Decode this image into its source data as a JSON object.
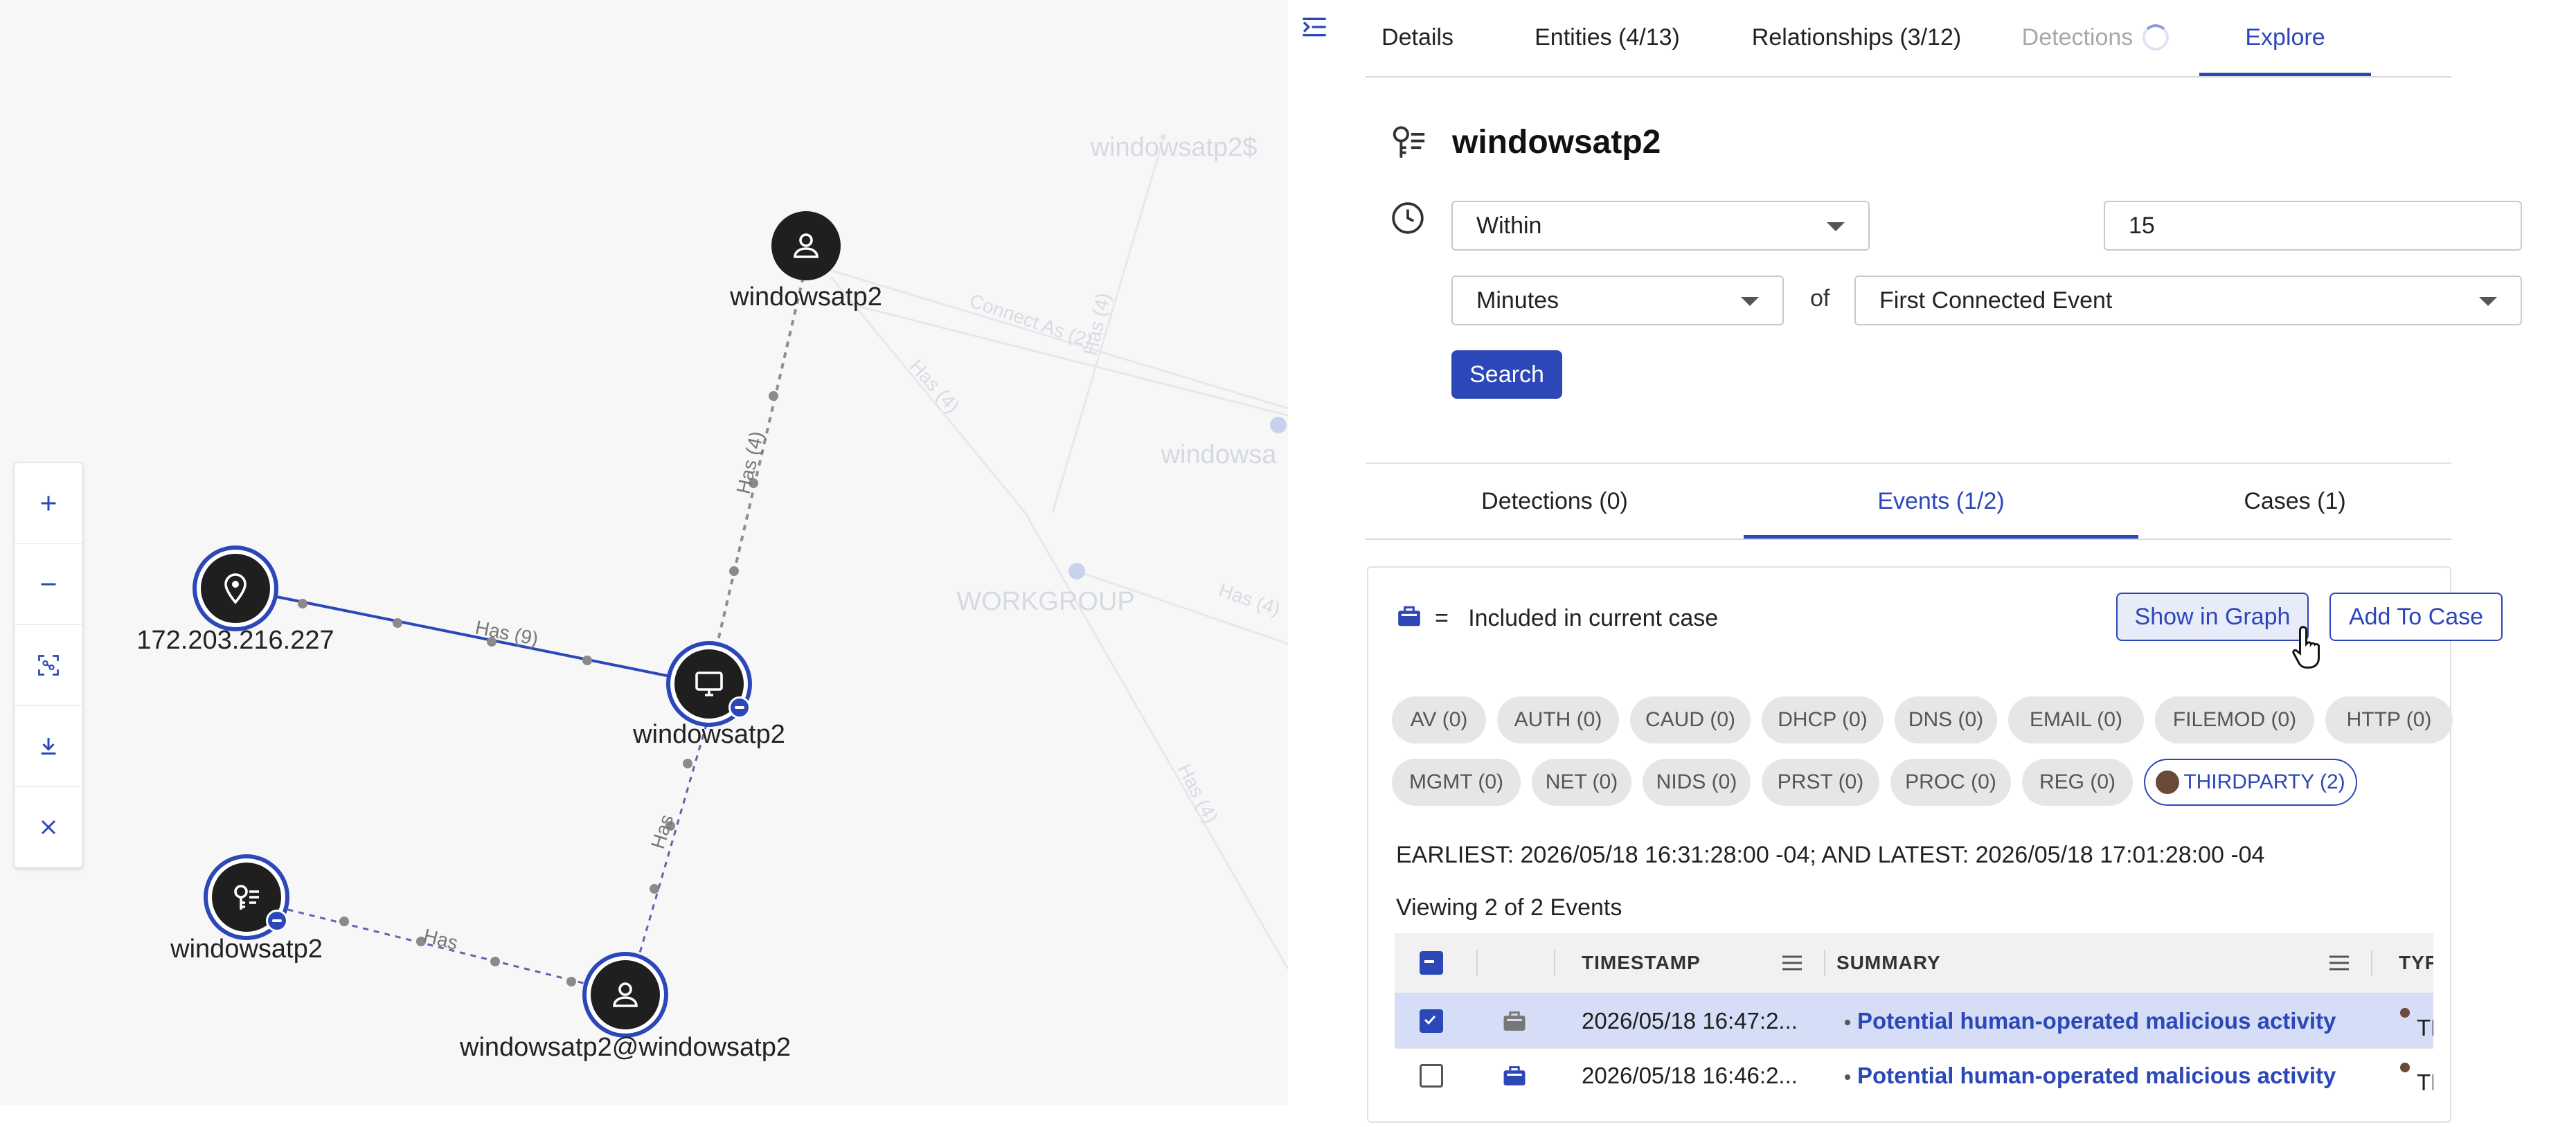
{
  "graph": {
    "nodes": [
      {
        "id": "user-top",
        "label": "windowsatp2",
        "icon": "user-icon"
      },
      {
        "id": "ip",
        "label": "172.203.216.227",
        "icon": "location-pin-icon"
      },
      {
        "id": "host",
        "label": "windowsatp2",
        "icon": "monitor-icon"
      },
      {
        "id": "key",
        "label": "windowsatp2",
        "icon": "key-list-icon"
      },
      {
        "id": "user-bottom",
        "label": "windowsatp2@windowsatp2",
        "icon": "user-icon"
      }
    ],
    "edge_labels": {
      "ip_host": "Has (9)",
      "user_host": "Has (4)",
      "host_userbottom": "Has",
      "key_userbottom": "Has"
    },
    "background_labels": {
      "windowsatp2_dollar": "windowsatp2$",
      "windowsa": "windowsa",
      "workgroup": "WORKGROUP",
      "connect_as": "Connect As (2)",
      "has4_a": "Has (4)",
      "has4_b": "Has (4)",
      "has4_c": "Has (4)",
      "has4_d": "Has (4)"
    },
    "controls": [
      "zoom-in-icon",
      "zoom-out-icon",
      "fit-view-icon",
      "download-icon",
      "close-icon"
    ]
  },
  "panel": {
    "tabs": [
      {
        "label": "Details",
        "state": "normal"
      },
      {
        "label": "Entities  (4/13)",
        "state": "normal"
      },
      {
        "label": "Relationships  (3/12)",
        "state": "normal"
      },
      {
        "label": "Detections",
        "state": "disabled"
      },
      {
        "label": "Explore",
        "state": "active"
      }
    ],
    "entity_title": "windowsatp2",
    "filter": {
      "condition": "Within",
      "amount": "15",
      "unit": "Minutes",
      "of_label": "of",
      "reference": "First Connected Event",
      "search_label": "Search"
    },
    "sub_tabs": [
      {
        "label": "Detections  (0)"
      },
      {
        "label": "Events  (1/2)"
      },
      {
        "label": "Cases  (1)"
      }
    ],
    "events": {
      "legend_eq": "=",
      "legend_text": "Included in current case",
      "show_in_graph": "Show in Graph",
      "add_to_case": "Add To Case",
      "chips": [
        {
          "label": "AV (0)"
        },
        {
          "label": "AUTH (0)"
        },
        {
          "label": "CAUD (0)"
        },
        {
          "label": "DHCP (0)"
        },
        {
          "label": "DNS (0)"
        },
        {
          "label": "EMAIL (0)"
        },
        {
          "label": "FILEMOD (0)"
        },
        {
          "label": "HTTP (0)"
        },
        {
          "label": "MGMT (0)"
        },
        {
          "label": "NET (0)"
        },
        {
          "label": "NIDS (0)"
        },
        {
          "label": "PRST (0)"
        },
        {
          "label": "PROC (0)"
        },
        {
          "label": "REG (0)"
        },
        {
          "label": "THIRDPARTY (2)"
        }
      ],
      "range_text": "EARLIEST:  2026/05/18 16:31:28:00 -04;  AND  LATEST:  2026/05/18 17:01:28:00 -04",
      "viewing_text": "Viewing 2 of 2 Events",
      "columns": {
        "timestamp": "TIMESTAMP",
        "summary": "SUMMARY",
        "type": "TYPE"
      },
      "rows": [
        {
          "timestamp": "2026/05/18 16:47:2...",
          "summary": "Potential human-operated malicious activity",
          "type": "THIRD",
          "selected": true
        },
        {
          "timestamp": "2026/05/18 16:46:2...",
          "summary": "Potential human-operated malicious activity",
          "type": "THIRD",
          "selected": false
        }
      ]
    }
  },
  "colors": {
    "accent": "#2c47b8",
    "node": "#1f1f1f",
    "thirdparty_dot": "#6b4a3a"
  }
}
